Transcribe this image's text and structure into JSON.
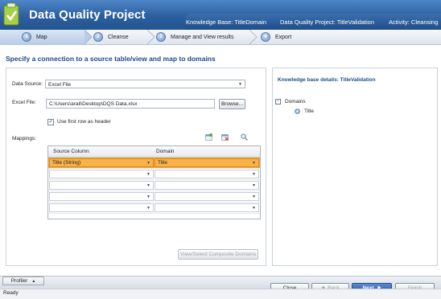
{
  "header": {
    "app_title": "Data Quality Project",
    "knowledge_base": "Knowledge Base: TitleDomain",
    "project": "Data Quality Project: TitleValidation",
    "activity": "Activity: Cleansing"
  },
  "steps": [
    {
      "num": "1",
      "label": "Map"
    },
    {
      "num": "2",
      "label": "Cleanse"
    },
    {
      "num": "3",
      "label": "Manage and View results"
    },
    {
      "num": "4",
      "label": "Export"
    }
  ],
  "main": {
    "heading": "Specify a connection to a source table/view and map to domains",
    "data_source_label": "Data Source:",
    "data_source_value": "Excel File",
    "excel_file_label": "Excel File:",
    "excel_file_path": "C:\\Users\\arali\\Desktop\\DQS Data.xlsx",
    "browse_label": "Browse...",
    "use_first_row_label": "Use first row as header",
    "mappings_label": "Mappings:",
    "grid": {
      "col_source": "Source Column",
      "col_domain": "Domain",
      "rows": [
        {
          "source": "Title (String)",
          "domain": "Title"
        },
        {
          "source": "",
          "domain": ""
        },
        {
          "source": "",
          "domain": ""
        },
        {
          "source": "",
          "domain": ""
        },
        {
          "source": "",
          "domain": ""
        }
      ]
    },
    "composite_button": "View/Select Composite Domains"
  },
  "kb_panel": {
    "title": "Knowledge base details: TitleValidation",
    "tree_root": "Domains",
    "tree_child": "Title"
  },
  "footer": {
    "profiler_tab": "Profiler",
    "close": "Close",
    "back": "Back",
    "next": "Next",
    "finish": "Finish",
    "status": "Ready"
  },
  "colors": {
    "header_blue": "#2b5f9f",
    "heading_blue": "#1c4a8c",
    "selection_orange": "#f7b24b"
  }
}
